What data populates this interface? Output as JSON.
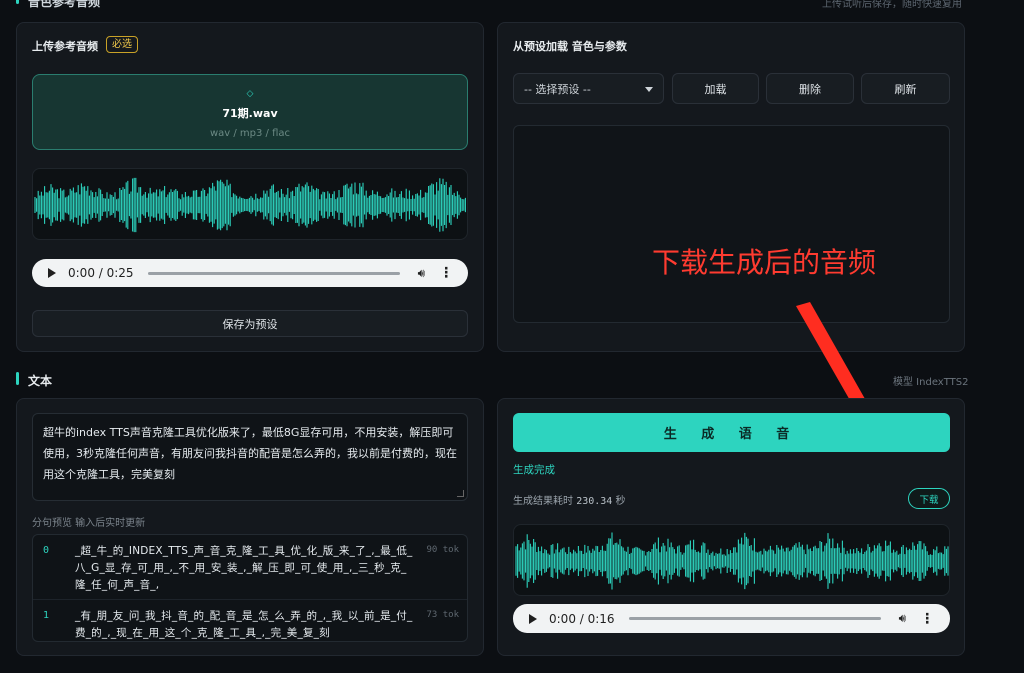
{
  "top": {
    "title": "音色参考音频",
    "right_text": "上传试听后保存，随时快速复用"
  },
  "upload_card": {
    "title": "上传参考音频",
    "required_badge": "必选",
    "file_name": "71期.wav",
    "formats_hint": "wav / mp3 / flac",
    "audio_time": "0:00 / 0:25",
    "audio_progress": 0,
    "save_preset_label": "保存为预设"
  },
  "preset_card": {
    "title": "从预设加载  音色与参数",
    "select_value": "-- 选择预设 --",
    "load_label": "加载",
    "delete_label": "删除",
    "refresh_label": "刷新"
  },
  "annotation": {
    "text": "下载生成后的音频",
    "color": "#ff3b30"
  },
  "text_section": {
    "title": "文本",
    "model_label": "模型 IndexTTS2",
    "input_value": "超牛的index TTS声音克隆工具优化版来了，最低8G显存可用，不用安装，解压即可使用，3秒克隆任何声音，有朋友问我抖音的配音是怎么弄的，我以前是付费的，现在用这个克隆工具，完美复刻",
    "segment_preview_label": "分句预览 输入后实时更新",
    "segments": [
      {
        "index": "0",
        "text": "_超_牛_的_INDEX_TTS_声_音_克_隆_工_具_优_化_版_来_了_,_最_低_八_G_显_存_可_用_,_不_用_安_装_,_解_压_即_可_使_用_,_三_秒_克_隆_任_何_声_音_,",
        "tokens": "90 tok"
      },
      {
        "index": "1",
        "text": "_有_朋_友_问_我_抖_音_的_配_音_是_怎_么_弄_的_,_我_以_前_是_付_费_的_,_现_在_用_这_个_克_隆_工_具_,_完_美_复_刻",
        "tokens": "73 tok"
      }
    ]
  },
  "generate_card": {
    "generate_label": "生 成 语 音",
    "status": "生成完成",
    "result_label": "生成结果",
    "elapsed_label": "耗时",
    "elapsed_value": "230.34",
    "elapsed_unit": "秒",
    "download_label": "下载",
    "audio_time": "0:00 / 0:16",
    "audio_progress": 0
  },
  "colors": {
    "accent": "#2dd4bf",
    "background": "#0c0f13",
    "card": "#14181d"
  }
}
